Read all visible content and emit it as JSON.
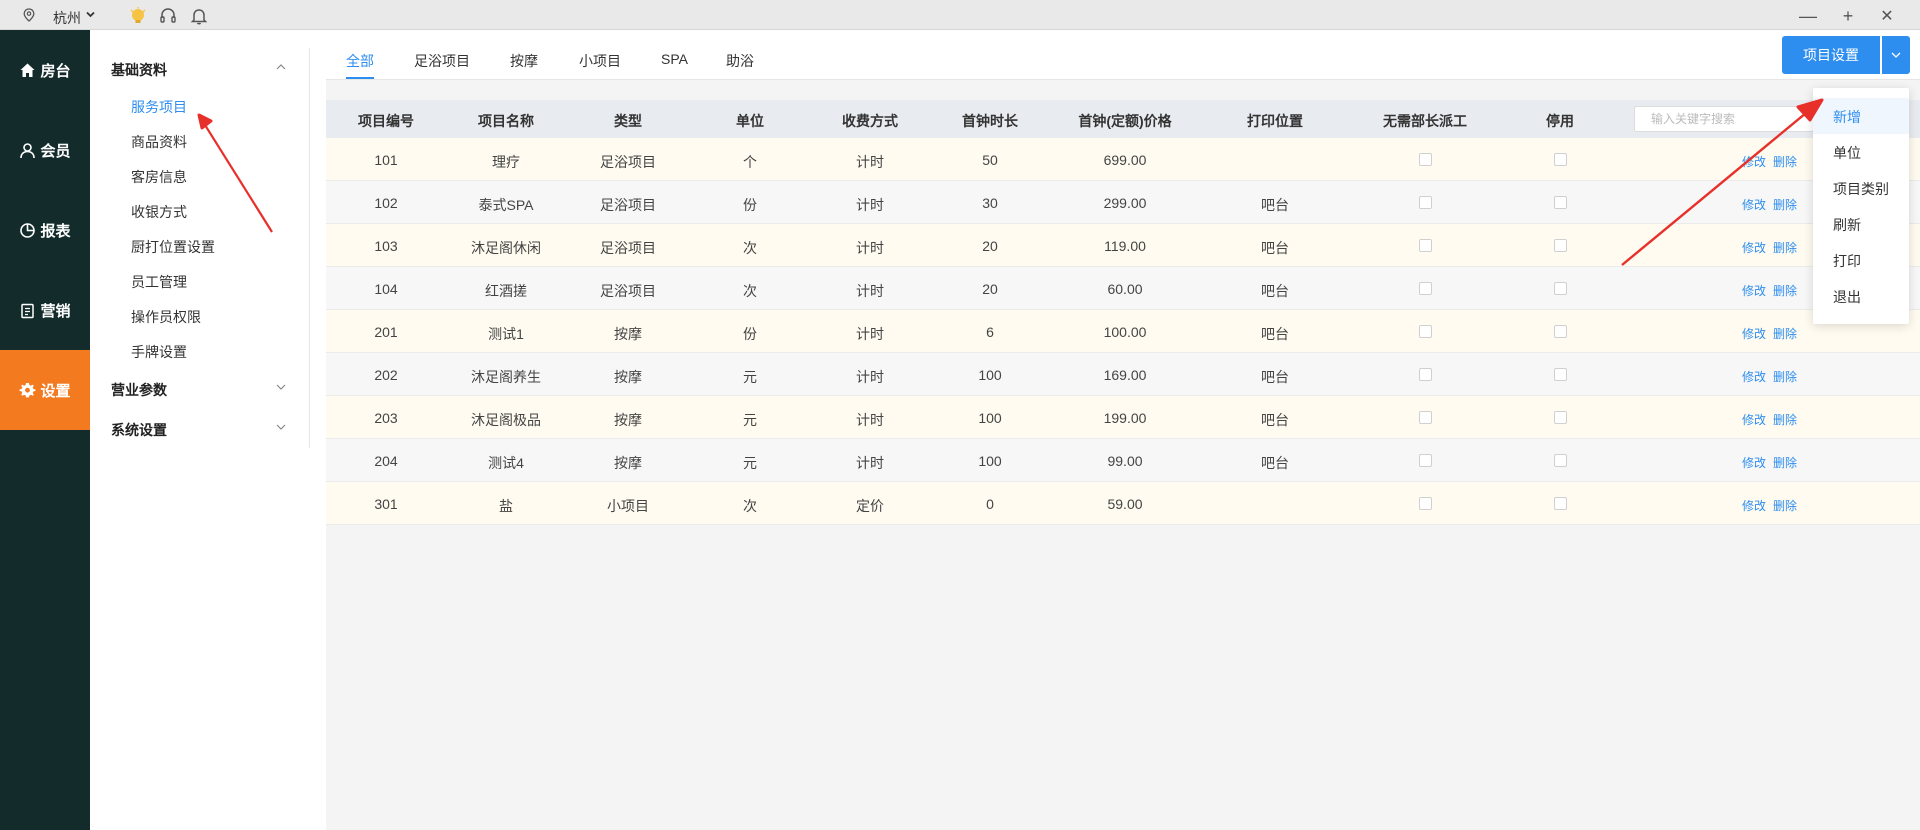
{
  "titlebar": {
    "city": "杭州",
    "icons": [
      "location-icon",
      "chevron-down-icon",
      "lightbulb-icon",
      "headset-icon",
      "bell-icon"
    ],
    "window_controls": {
      "minimize": "—",
      "maximize": "+",
      "close": "✕"
    }
  },
  "leftnav": {
    "items": [
      {
        "label": "房台",
        "icon": "home-icon"
      },
      {
        "label": "会员",
        "icon": "user-icon"
      },
      {
        "label": "报表",
        "icon": "pie-chart-icon"
      },
      {
        "label": "营销",
        "icon": "clipboard-icon"
      },
      {
        "label": "设置",
        "icon": "gear-icon",
        "active": true
      }
    ],
    "active_color": "#f47a20",
    "bg_color": "#132b2b"
  },
  "submenu": {
    "groups": [
      {
        "label": "基础资料",
        "expanded": true,
        "items": [
          "服务项目",
          "商品资料",
          "客房信息",
          "收银方式",
          "厨打位置设置",
          "员工管理",
          "操作员权限",
          "手牌设置"
        ],
        "active_item": "服务项目"
      },
      {
        "label": "营业参数",
        "expanded": false
      },
      {
        "label": "系统设置",
        "expanded": false
      }
    ]
  },
  "tabs": {
    "items": [
      "全部",
      "足浴项目",
      "按摩",
      "小项目",
      "SPA",
      "助浴"
    ],
    "active": "全部"
  },
  "settings_button": {
    "label": "项目设置",
    "color": "#2e8ef0"
  },
  "table": {
    "headers": [
      "项目编号",
      "项目名称",
      "类型",
      "单位",
      "收费方式",
      "首钟时长",
      "首钟(定额)价格",
      "打印位置",
      "无需部长派工",
      "停用"
    ],
    "search_placeholder": "输入关键字搜索",
    "action_labels": {
      "edit": "修改",
      "delete": "删除"
    },
    "rows": [
      {
        "id": "101",
        "name": "理疗",
        "type": "足浴项目",
        "unit": "个",
        "charge": "计时",
        "duration": "50",
        "price": "699.00",
        "print": ""
      },
      {
        "id": "102",
        "name": "泰式SPA",
        "type": "足浴项目",
        "unit": "份",
        "charge": "计时",
        "duration": "30",
        "price": "299.00",
        "print": "吧台"
      },
      {
        "id": "103",
        "name": "沐足阁休闲",
        "type": "足浴项目",
        "unit": "次",
        "charge": "计时",
        "duration": "20",
        "price": "119.00",
        "print": "吧台"
      },
      {
        "id": "104",
        "name": "红酒搓",
        "type": "足浴项目",
        "unit": "次",
        "charge": "计时",
        "duration": "20",
        "price": "60.00",
        "print": "吧台"
      },
      {
        "id": "201",
        "name": "测试1",
        "type": "按摩",
        "unit": "份",
        "charge": "计时",
        "duration": "6",
        "price": "100.00",
        "print": "吧台"
      },
      {
        "id": "202",
        "name": "沐足阁养生",
        "type": "按摩",
        "unit": "元",
        "charge": "计时",
        "duration": "100",
        "price": "169.00",
        "print": "吧台"
      },
      {
        "id": "203",
        "name": "沐足阁极品",
        "type": "按摩",
        "unit": "元",
        "charge": "计时",
        "duration": "100",
        "price": "199.00",
        "print": "吧台"
      },
      {
        "id": "204",
        "name": "测试4",
        "type": "按摩",
        "unit": "元",
        "charge": "计时",
        "duration": "100",
        "price": "99.00",
        "print": "吧台"
      },
      {
        "id": "301",
        "name": "盐",
        "type": "小项目",
        "unit": "次",
        "charge": "定价",
        "duration": "0",
        "price": "59.00",
        "print": ""
      }
    ]
  },
  "dropdown": {
    "items": [
      "新增",
      "单位",
      "项目类别",
      "刷新",
      "打印",
      "退出"
    ],
    "active": "新增"
  },
  "annotation_color": "#e8302a"
}
